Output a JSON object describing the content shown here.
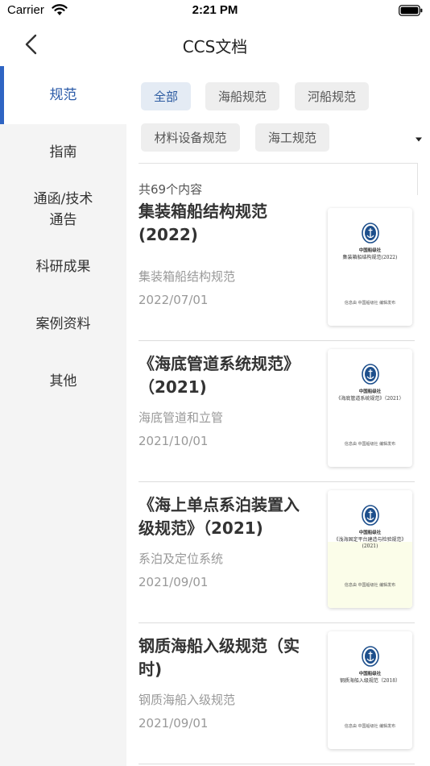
{
  "status_bar": {
    "carrier": "Carrier",
    "time": "2:21 PM"
  },
  "nav": {
    "title": "CCS文档",
    "back_icon": "chevron-left-icon"
  },
  "sidebar": {
    "items": [
      {
        "label": "规范",
        "active": true
      },
      {
        "label": "指南",
        "active": false
      },
      {
        "label": "通函/技术\n通告",
        "active": false
      },
      {
        "label": "科研成果",
        "active": false
      },
      {
        "label": "案例资料",
        "active": false
      },
      {
        "label": "其他",
        "active": false
      }
    ]
  },
  "filters": {
    "chips": [
      {
        "label": "全部",
        "active": true
      },
      {
        "label": "海船规范",
        "active": false
      },
      {
        "label": "河船规范",
        "active": false
      },
      {
        "label": "材料设备规范",
        "active": false
      },
      {
        "label": "海工规范",
        "active": false
      }
    ],
    "expand_icon": "caret-down-icon"
  },
  "results": {
    "count_text": "共69个内容",
    "items": [
      {
        "title": "集装箱船结构规范(2022)",
        "subtitle": "集装箱船结构规范",
        "date": "2022/07/01",
        "cover": {
          "org": "中国船级社",
          "title": "集装箱船结构规范(2022)",
          "publisher": "信息由 中国船级社 编辑发布"
        }
      },
      {
        "title": "《海底管道系统规范》（2021)",
        "subtitle": "海底管道和立管",
        "date": "2021/10/01",
        "cover": {
          "org": "中国船级社",
          "title": "《海底管道系统规范》（2021）",
          "publisher": "信息由 中国船级社 编辑发布"
        }
      },
      {
        "title": "《海上单点系泊装置入级规范》（2021)",
        "subtitle": "系泊及定位系统",
        "date": "2021/09/01",
        "cover": {
          "org": "中国船级社",
          "title": "《浅海固定平台建造与检验规范》(2021)",
          "publisher": "信息由 中国船级社 编辑发布"
        }
      },
      {
        "title": "钢质海船入级规范（实时)",
        "subtitle": "钢质海船入级规范",
        "date": "2021/09/01",
        "cover": {
          "org": "中国船级社",
          "title": "钢质海船入级规范（2018）",
          "publisher": "信息由 中国船级社 编辑发布"
        }
      }
    ]
  },
  "colors": {
    "accent": "#2e64c3",
    "sidebar_bg": "#f4f4f4",
    "chip_bg": "#eeeeee",
    "chip_active_bg": "#e4ebf4"
  }
}
